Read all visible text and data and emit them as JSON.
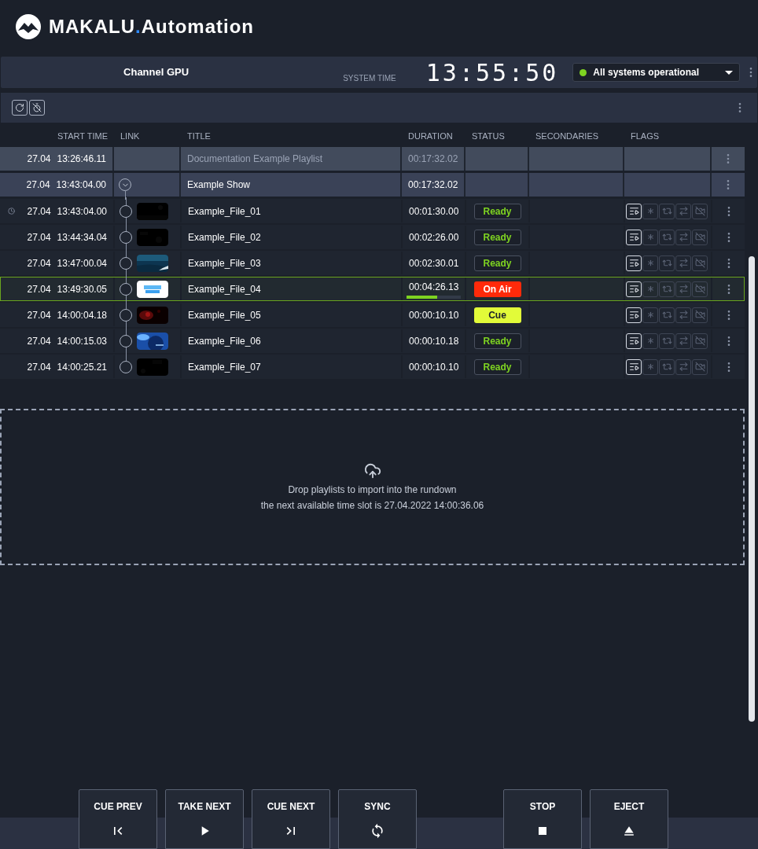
{
  "app": {
    "brand": "MAKALU",
    "brand_dot": ".",
    "brand_suffix": "Automation"
  },
  "channel_bar": {
    "channel": "Channel GPU",
    "clock_label": "SYSTEM TIME",
    "clock": "13:55:50",
    "status": {
      "label": "All systems operational",
      "operational": true
    }
  },
  "columns": [
    "START TIME",
    "LINK",
    "TITLE",
    "DURATION",
    "STATUS",
    "SECONDARIES",
    "FLAGS"
  ],
  "rows": [
    {
      "kind": "playlist",
      "date": "27.04",
      "time": "13:26:46.11",
      "title": "Documentation Example Playlist",
      "duration": "00:17:32.02"
    },
    {
      "kind": "show",
      "expanded": true,
      "date": "27.04",
      "time": "13:43:04.00",
      "title": "Example Show",
      "duration": "00:17:32.02"
    },
    {
      "kind": "file",
      "timed": true,
      "selected": false,
      "date": "27.04",
      "time": "13:43:04.00",
      "title": "Example_File_01",
      "duration": "00:01:30.00",
      "status": {
        "kind": "ready",
        "label": "Ready"
      },
      "flags": [
        {
          "kind": "playlist",
          "on": true
        },
        {
          "kind": "freeze",
          "on": false
        },
        {
          "kind": "loop",
          "on": false
        },
        {
          "kind": "route",
          "on": false
        },
        {
          "kind": "no-video",
          "on": false
        }
      ]
    },
    {
      "kind": "file",
      "timed": false,
      "selected": false,
      "date": "27.04",
      "time": "13:44:34.04",
      "title": "Example_File_02",
      "duration": "00:02:26.00",
      "status": {
        "kind": "ready",
        "label": "Ready"
      },
      "flags": [
        {
          "kind": "playlist",
          "on": true
        },
        {
          "kind": "freeze",
          "on": false
        },
        {
          "kind": "loop",
          "on": false
        },
        {
          "kind": "route",
          "on": false
        },
        {
          "kind": "no-video",
          "on": false
        }
      ]
    },
    {
      "kind": "file",
      "timed": false,
      "selected": false,
      "date": "27.04",
      "time": "13:47:00.04",
      "title": "Example_File_03",
      "duration": "00:02:30.01",
      "status": {
        "kind": "ready",
        "label": "Ready"
      },
      "flags": [
        {
          "kind": "playlist",
          "on": true
        },
        {
          "kind": "freeze",
          "on": false
        },
        {
          "kind": "loop",
          "on": false
        },
        {
          "kind": "route",
          "on": false
        },
        {
          "kind": "no-video",
          "on": false
        }
      ]
    },
    {
      "kind": "file",
      "timed": false,
      "selected": true,
      "level": 0.57,
      "date": "27.04",
      "time": "13:49:30.05",
      "title": "Example_File_04",
      "duration": "00:04:26.13",
      "status": {
        "kind": "on_air",
        "label": "On Air"
      },
      "flags": [
        {
          "kind": "playlist",
          "on": true
        },
        {
          "kind": "freeze",
          "on": false
        },
        {
          "kind": "loop",
          "on": false
        },
        {
          "kind": "route",
          "on": false
        },
        {
          "kind": "no-video",
          "on": false
        }
      ]
    },
    {
      "kind": "file",
      "timed": false,
      "selected": false,
      "date": "27.04",
      "time": "14:00:04.18",
      "title": "Example_File_05",
      "duration": "00:00:10.10",
      "status": {
        "kind": "cue",
        "label": "Cue"
      },
      "flags": [
        {
          "kind": "playlist",
          "on": true
        },
        {
          "kind": "freeze",
          "on": false
        },
        {
          "kind": "loop",
          "on": false
        },
        {
          "kind": "route",
          "on": false
        },
        {
          "kind": "no-video",
          "on": false
        }
      ]
    },
    {
      "kind": "file",
      "timed": false,
      "selected": false,
      "date": "27.04",
      "time": "14:00:15.03",
      "title": "Example_File_06",
      "duration": "00:00:10.18",
      "status": {
        "kind": "ready",
        "label": "Ready"
      },
      "flags": [
        {
          "kind": "playlist",
          "on": true
        },
        {
          "kind": "freeze",
          "on": false
        },
        {
          "kind": "loop",
          "on": false
        },
        {
          "kind": "route",
          "on": false
        },
        {
          "kind": "no-video",
          "on": false
        }
      ]
    },
    {
      "kind": "file",
      "timed": false,
      "selected": false,
      "date": "27.04",
      "time": "14:00:25.21",
      "title": "Example_File_07",
      "duration": "00:00:10.10",
      "status": {
        "kind": "ready",
        "label": "Ready"
      },
      "flags": [
        {
          "kind": "playlist",
          "on": true
        },
        {
          "kind": "freeze",
          "on": false
        },
        {
          "kind": "loop",
          "on": false
        },
        {
          "kind": "route",
          "on": false
        },
        {
          "kind": "no-video",
          "on": false
        }
      ]
    }
  ],
  "drop_zone": {
    "line_1": "Drop playlists to import into the rundown",
    "line_2": "the next available time slot is 27.04.2022 14:00:36.06"
  },
  "controls": [
    {
      "kind": "cue_prev",
      "label": "CUE PREV"
    },
    {
      "kind": "take_next",
      "label": "TAKE NEXT"
    },
    {
      "kind": "cue_next",
      "label": "CUE NEXT"
    },
    {
      "kind": "sync",
      "label": "SYNC"
    },
    {
      "kind": "stop",
      "label": "STOP"
    },
    {
      "kind": "eject",
      "label": "EJECT"
    }
  ]
}
